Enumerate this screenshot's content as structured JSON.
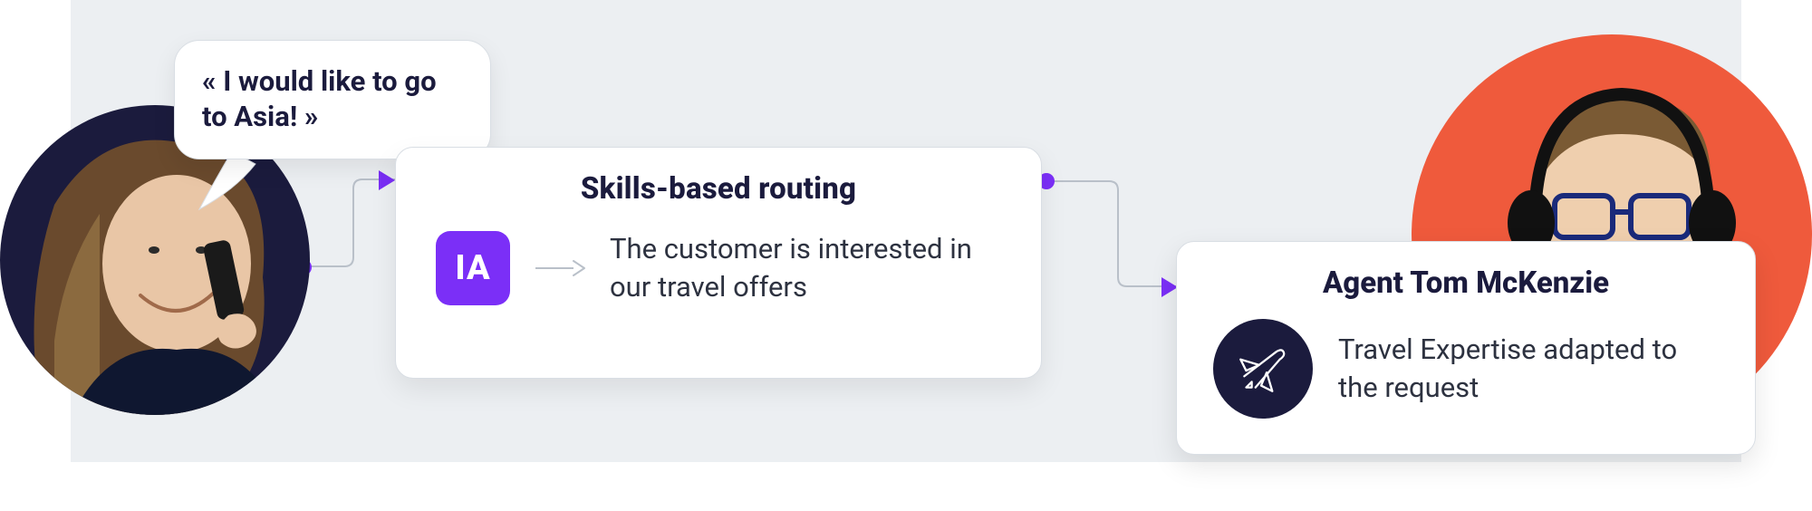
{
  "customer": {
    "speech": "« I would like to go to Asia! »"
  },
  "routing": {
    "title": "Skills-based routing",
    "ia_label": "IA",
    "description": "The customer is interested in our travel offers"
  },
  "agent": {
    "title": "Agent Tom McKenzie",
    "skill_description": "Travel Expertise adapted to the request"
  }
}
